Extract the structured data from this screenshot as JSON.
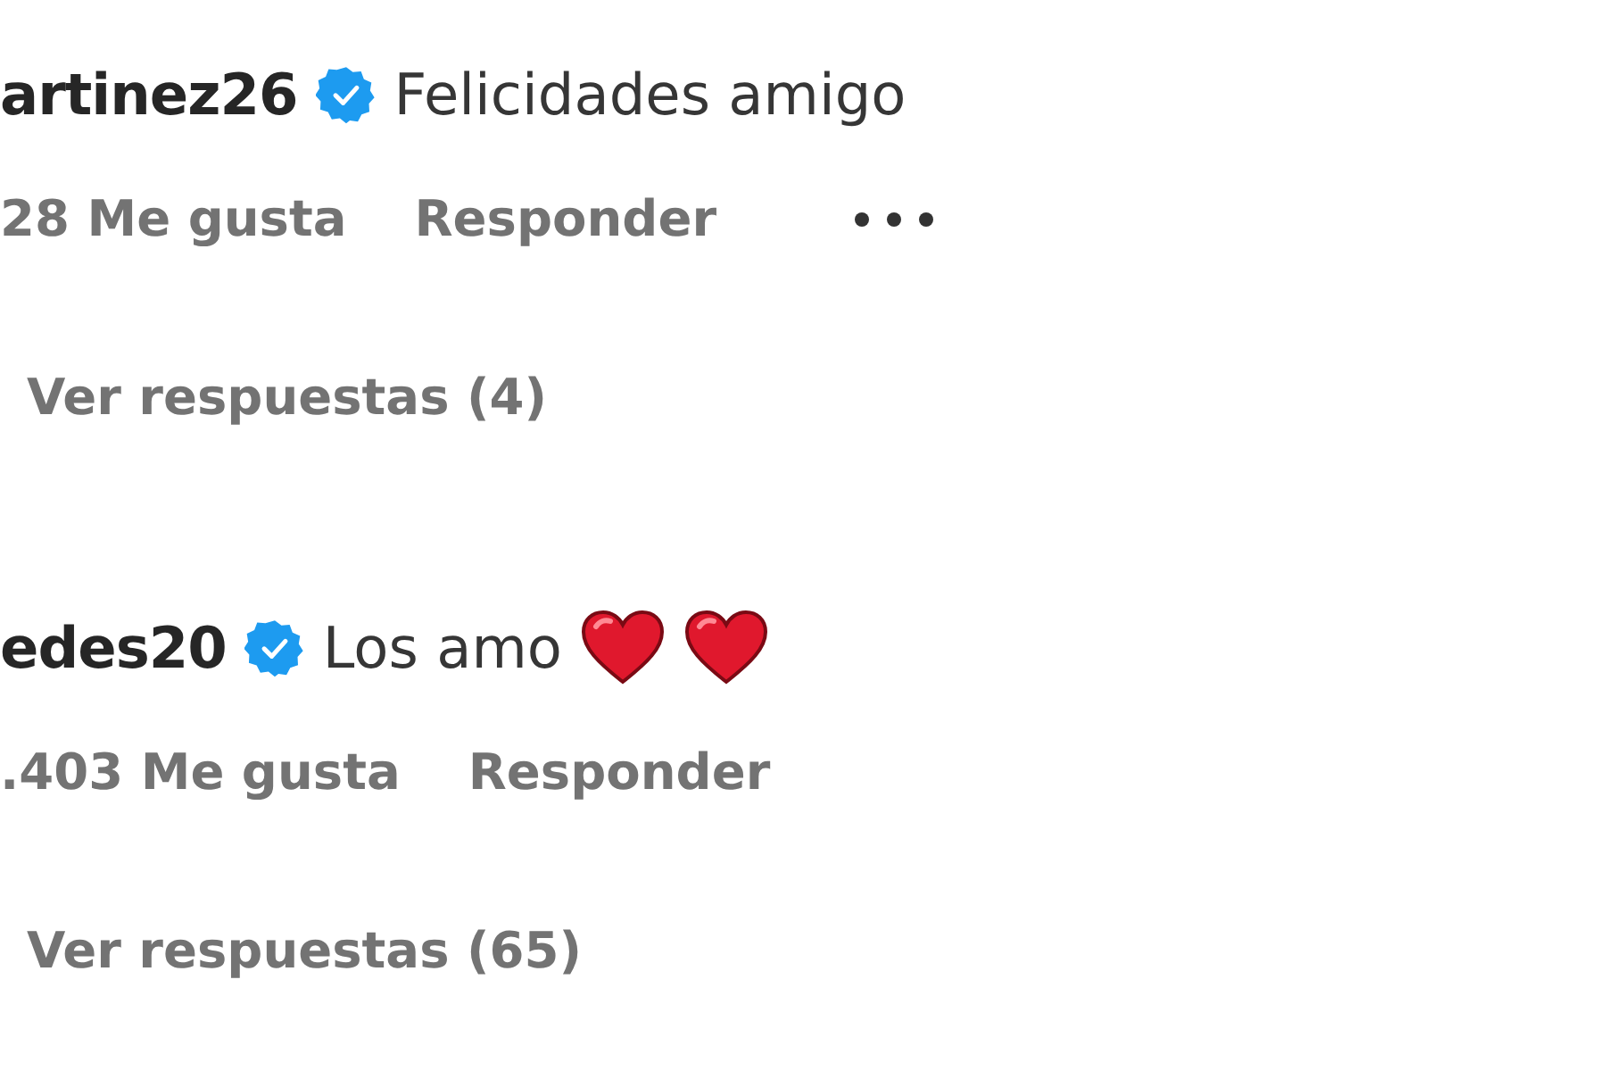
{
  "comments": [
    {
      "username": "artinez26",
      "verified": true,
      "text": "Felicidades amigo",
      "likes": "28 Me gusta",
      "reply": "Responder",
      "has_menu": true,
      "view_replies": "Ver respuestas (4)"
    },
    {
      "username": "edes20",
      "verified": true,
      "text": "Los amo",
      "emojis": [
        {
          "kind": "heart"
        },
        {
          "kind": "heart"
        }
      ],
      "likes": ".403 Me gusta",
      "reply": "Responder",
      "has_menu": false,
      "view_replies": "Ver respuestas (65)"
    }
  ]
}
